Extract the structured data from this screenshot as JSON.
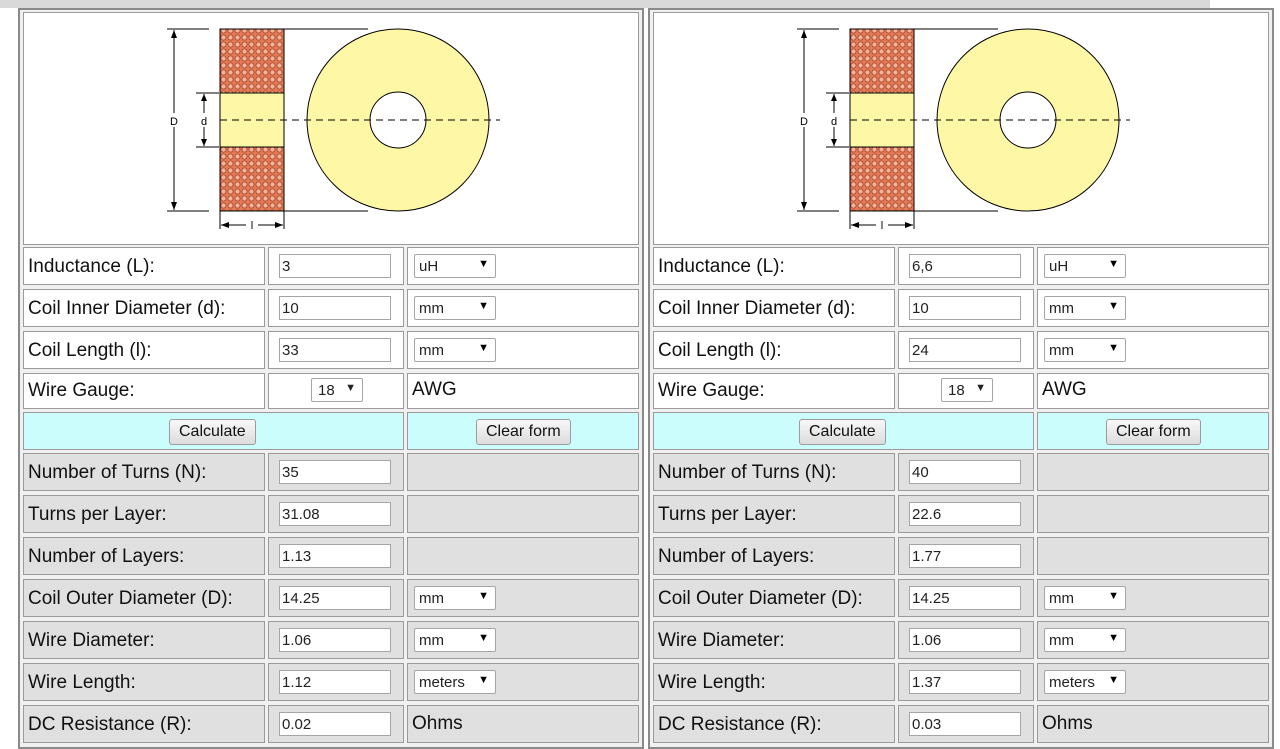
{
  "calculators": [
    {
      "diagram": {
        "outer_label": "D",
        "inner_label": "d",
        "length_label": "l"
      },
      "inductance": {
        "label": "Inductance (L):",
        "value": "3",
        "unit": "uH"
      },
      "inner_diameter": {
        "label": "Coil Inner Diameter (d):",
        "value": "10",
        "unit": "mm"
      },
      "coil_length": {
        "label": "Coil Length (l):",
        "value": "33",
        "unit": "mm"
      },
      "wire_gauge": {
        "label": "Wire Gauge:",
        "value": "18",
        "unit": "AWG"
      },
      "buttons": {
        "calculate": "Calculate",
        "clear": "Clear form"
      },
      "turns": {
        "label": "Number of Turns (N):",
        "value": "35"
      },
      "turns_per_layer": {
        "label": "Turns per Layer:",
        "value": "31.08"
      },
      "layers": {
        "label": "Number of Layers:",
        "value": "1.13"
      },
      "outer_diameter": {
        "label": "Coil Outer Diameter (D):",
        "value": "14.25",
        "unit": "mm"
      },
      "wire_diameter": {
        "label": "Wire Diameter:",
        "value": "1.06",
        "unit": "mm"
      },
      "wire_length": {
        "label": "Wire Length:",
        "value": "1.12",
        "unit": "meters"
      },
      "dc_resistance": {
        "label": "DC Resistance (R):",
        "value": "0.02",
        "unit": "Ohms"
      }
    },
    {
      "diagram": {
        "outer_label": "D",
        "inner_label": "d",
        "length_label": "l"
      },
      "inductance": {
        "label": "Inductance (L):",
        "value": "6,6",
        "unit": "uH"
      },
      "inner_diameter": {
        "label": "Coil Inner Diameter (d):",
        "value": "10",
        "unit": "mm"
      },
      "coil_length": {
        "label": "Coil Length (l):",
        "value": "24",
        "unit": "mm"
      },
      "wire_gauge": {
        "label": "Wire Gauge:",
        "value": "18",
        "unit": "AWG"
      },
      "buttons": {
        "calculate": "Calculate",
        "clear": "Clear form"
      },
      "turns": {
        "label": "Number of Turns (N):",
        "value": "40"
      },
      "turns_per_layer": {
        "label": "Turns per Layer:",
        "value": "22.6"
      },
      "layers": {
        "label": "Number of Layers:",
        "value": "1.77"
      },
      "outer_diameter": {
        "label": "Coil Outer Diameter (D):",
        "value": "14.25",
        "unit": "mm"
      },
      "wire_diameter": {
        "label": "Wire Diameter:",
        "value": "1.06",
        "unit": "mm"
      },
      "wire_length": {
        "label": "Wire Length:",
        "value": "1.37",
        "unit": "meters"
      },
      "dc_resistance": {
        "label": "DC Resistance (R):",
        "value": "0.03",
        "unit": "Ohms"
      }
    }
  ],
  "colors": {
    "winding": "#e07a55",
    "core": "#fdf7a6",
    "button_row": "#ccfdfd",
    "output_row": "#e0e0e0"
  }
}
